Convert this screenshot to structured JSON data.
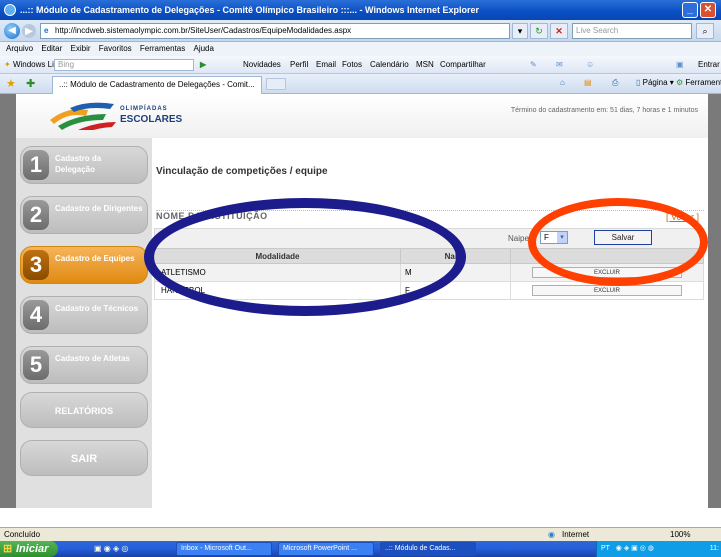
{
  "window": {
    "title": "...:: Módulo de Cadastramento de Delegações - Comitê Olímpico Brasileiro :::... - Windows Internet Explorer"
  },
  "browser": {
    "address": "http://incdweb.sistemaolympic.com.br/SiteUser/Cadastros/EquipeModalidades.aspx",
    "search_placeholder": "Live Search",
    "menu": [
      "Arquivo",
      "Editar",
      "Exibir",
      "Favoritos",
      "Ferramentas",
      "Ajuda"
    ],
    "toolbar_left": "Windows Live",
    "toolbar_search": "Bing",
    "toolbar_items": [
      "Novidades",
      "Perfil",
      "Email",
      "Fotos",
      "Calendário",
      "MSN",
      "Compartilhar"
    ],
    "toolbar_right": "Entrar",
    "tab_title": "..:: Módulo de Cadastramento de Delegações - Comit...",
    "page_menu": "Página",
    "tools_menu": "Ferramentas",
    "status_left": "Concluído",
    "status_zone": "Internet",
    "zoom": "100%"
  },
  "site": {
    "logo_line1": "OLIMPÍADAS",
    "logo_line2": "ESCOLARES",
    "deadline": "Término do cadastramento em: 51 dias, 7 horas e 1 minutos"
  },
  "nav": [
    {
      "num": "1",
      "label": "Cadastro da Delegação"
    },
    {
      "num": "2",
      "label": "Cadastro de Dirigentes"
    },
    {
      "num": "3",
      "label": "Cadastro de Equipes"
    },
    {
      "num": "4",
      "label": "Cadastro de Técnicos"
    },
    {
      "num": "5",
      "label": "Cadastro de Atletas"
    }
  ],
  "nav_reports": "RELATÓRIOS",
  "nav_exit": "SAIR",
  "main": {
    "title": "Vinculação de competições / equipe",
    "institution": "NOME DA INSTITUIÇÃO",
    "back_link": "[ Voltar ]",
    "naipe_label": "Naipe:",
    "naipe_value": "F",
    "save_label": "Salvar",
    "columns": [
      "Modalidade",
      "Naipe"
    ],
    "rows": [
      {
        "modalidade": "ATLETISMO",
        "naipe": "M",
        "action": "EXCLUIR"
      },
      {
        "modalidade": "HANDEBOL",
        "naipe": "F",
        "action": "EXCLUIR"
      }
    ]
  },
  "taskbar": {
    "start": "Iniciar",
    "items": [
      "Inbox - Microsoft Out...",
      "Microsoft PowerPoint ...",
      "..:: Módulo de Cadas..."
    ],
    "tray_lang": "PT",
    "clock": "11:"
  },
  "colors": {
    "accent_orange": "#e08a10",
    "oval_blue": "#1c1c8c",
    "oval_red": "#ff4000",
    "link": "#cc6600"
  }
}
